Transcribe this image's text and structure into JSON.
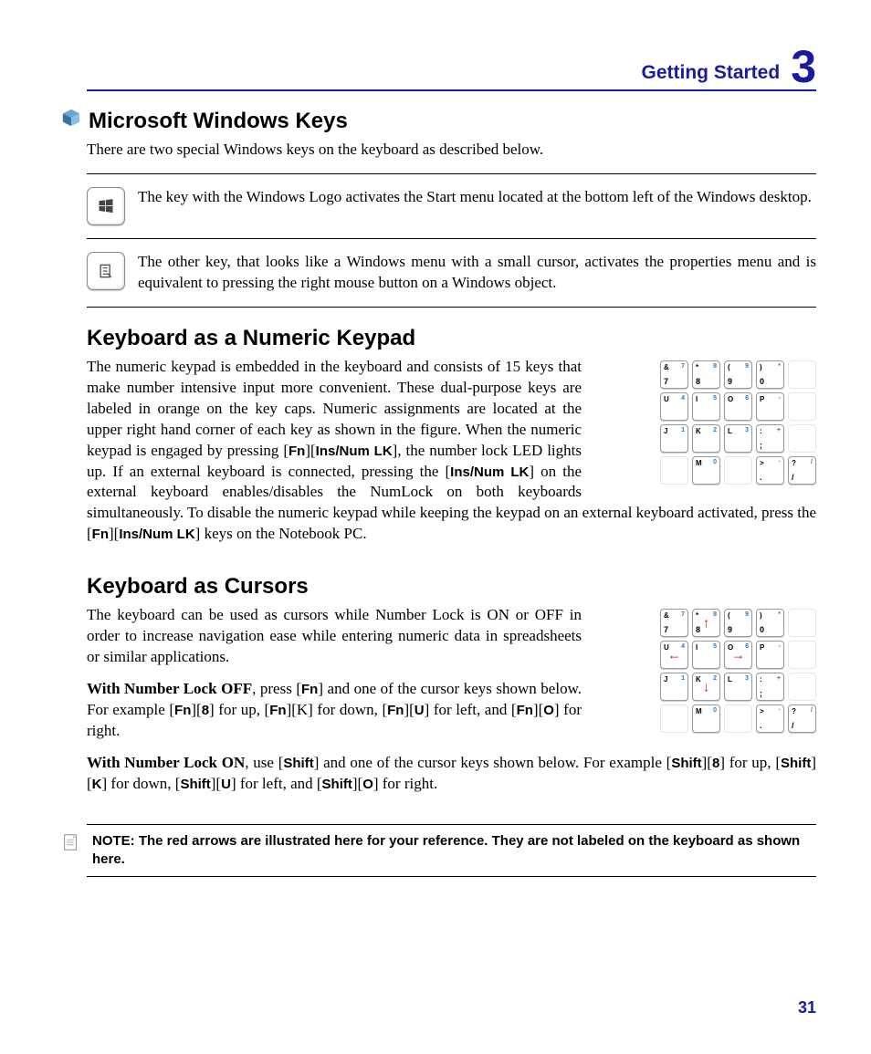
{
  "header": {
    "title": "Getting Started",
    "chapter": "3"
  },
  "page_number": "31",
  "section1": {
    "heading": "Microsoft Windows Keys",
    "intro": "There are two special Windows keys on the keyboard as described below.",
    "item1": "The key with the Windows Logo activates the Start menu located at the bottom left of the Windows desktop.",
    "item2": "The other key, that looks like a Windows menu with a small cursor, activates the properties menu and is equivalent to pressing the right mouse button on a Windows object."
  },
  "section2": {
    "heading": "Keyboard as a Numeric Keypad",
    "p1a": "The numeric keypad is embedded in the keyboard and consists of 15 keys that make number intensive input more convenient. These dual-purpose keys are labeled in orange on the key caps. Numeric assignments are located at the upper right hand corner of each key as shown in the figure. When the numeric keypad is engaged by pressing [",
    "k1": "Fn",
    "p1b": "][",
    "k2": "Ins/Num LK",
    "p1c": "], the number lock LED lights up. If an external keyboard is connected, pressing the [",
    "k3": "Ins/Num LK",
    "p1d": "] on the external keyboard enables/disables the NumLock on both keyboards simultaneously. To disable the numeric keypad while keeping the keypad on an external keyboard activated, press the  [",
    "k4": "Fn",
    "p1e": "][",
    "k5": "Ins/Num LK",
    "p1f": "] keys on the Notebook PC."
  },
  "section3": {
    "heading": "Keyboard as Cursors",
    "p1": "The keyboard can be used as cursors while Number Lock is ON or OFF in order to increase navigation ease while entering numeric data in spreadsheets or similar applications.",
    "p2_lead": "With Number Lock OFF",
    "p2a": ", press [",
    "p2k1": "Fn",
    "p2b": "] and one of the cursor keys shown below. For example [",
    "p2k2": "Fn",
    "p2c": "][",
    "p2k3": "8",
    "p2d": "] for up, [",
    "p2k4": "Fn",
    "p2e": "][K] for down, [",
    "p2k5": "Fn",
    "p2f": "][",
    "p2k6": "U",
    "p2g": "] for left, and [",
    "p2k7": "Fn",
    "p2h": "][",
    "p2k8": "O",
    "p2i": "] for right.",
    "p3_lead": "With Number Lock ON",
    "p3a": ", use [",
    "p3k1": "Shift",
    "p3b": "] and one of the cursor keys shown below. For example [",
    "p3k2": "Shift",
    "p3c": "][",
    "p3k3": "8",
    "p3d": "] for up, [",
    "p3k4": "Shift",
    "p3e": "][",
    "p3k5": "K",
    "p3f": "] for down, [",
    "p3k6": "Shift",
    "p3g": "][",
    "p3k7": "U",
    "p3h": "] for left, and [",
    "p3k8": "Shift",
    "p3i": "][",
    "p3k9": "O",
    "p3j": "] for right."
  },
  "note": {
    "text": "NOTE: The red arrows are illustrated here for your reference. They are not labeled on the keyboard as shown here."
  },
  "keypad_rows": [
    [
      {
        "tl": "&",
        "tr": "7",
        "bl": "7"
      },
      {
        "tl": "*",
        "tr": "8",
        "bl": "8"
      },
      {
        "tl": "(",
        "tr": "9",
        "bl": "9"
      },
      {
        "tl": ")",
        "tr": "*",
        "bl": "0"
      },
      {
        "ghost": true
      }
    ],
    [
      {
        "tl": "U",
        "tr": "4"
      },
      {
        "tl": "I",
        "tr": "5"
      },
      {
        "tl": "O",
        "tr": "6"
      },
      {
        "tl": "P",
        "tr": "-"
      },
      {
        "ghost": true
      }
    ],
    [
      {
        "tl": "J",
        "tr": "1"
      },
      {
        "tl": "K",
        "tr": "2"
      },
      {
        "tl": "L",
        "tr": "3"
      },
      {
        "tl": ":",
        "tr": "+",
        "bl": ";"
      },
      {
        "ghost": true
      }
    ],
    [
      {
        "ghost": true
      },
      {
        "tl": "M",
        "tr": "0"
      },
      {
        "ghost": true
      },
      {
        "tl": ">",
        "tr": "·",
        "bl": "."
      },
      {
        "tl": "?",
        "tr": "/",
        "bl": "/"
      }
    ]
  ],
  "cursor_rows": [
    [
      {
        "tl": "&",
        "tr": "7",
        "bl": "7"
      },
      {
        "tl": "*",
        "tr": "8",
        "bl": "8",
        "arrow": "↑",
        "color": "red"
      },
      {
        "tl": "(",
        "tr": "9",
        "bl": "9"
      },
      {
        "tl": ")",
        "tr": "*",
        "bl": "0"
      },
      {
        "ghost": true
      }
    ],
    [
      {
        "tl": "U",
        "tr": "4",
        "arrow": "←",
        "color": "red"
      },
      {
        "tl": "I",
        "tr": "5"
      },
      {
        "tl": "O",
        "tr": "6",
        "arrow": "→",
        "color": "red"
      },
      {
        "tl": "P",
        "tr": "-"
      },
      {
        "ghost": true
      }
    ],
    [
      {
        "tl": "J",
        "tr": "1"
      },
      {
        "tl": "K",
        "tr": "2",
        "arrow": "↓",
        "color": "red"
      },
      {
        "tl": "L",
        "tr": "3"
      },
      {
        "tl": ":",
        "tr": "+",
        "bl": ";"
      },
      {
        "ghost": true
      }
    ],
    [
      {
        "ghost": true
      },
      {
        "tl": "M",
        "tr": "0"
      },
      {
        "ghost": true
      },
      {
        "tl": ">",
        "tr": "·",
        "bl": "."
      },
      {
        "tl": "?",
        "tr": "/",
        "bl": "/"
      }
    ]
  ]
}
